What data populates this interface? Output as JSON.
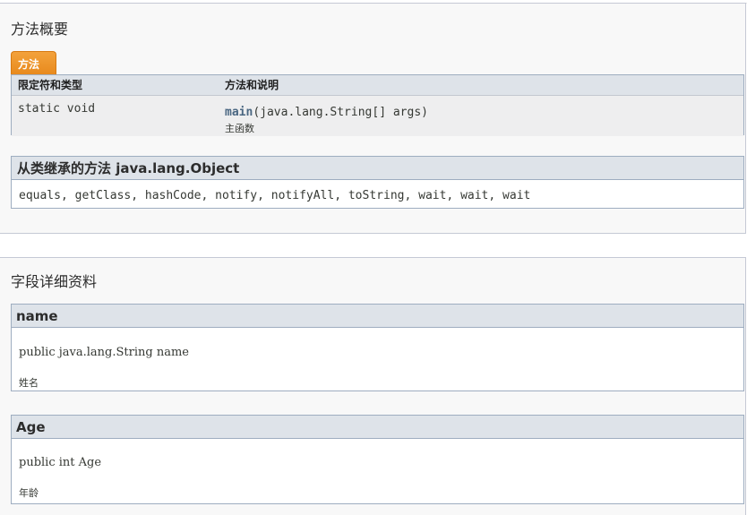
{
  "method_summary": {
    "title": "方法概要",
    "tab_label": "方法",
    "table": {
      "headers": [
        "限定符和类型",
        "方法和说明"
      ],
      "rows": [
        {
          "modifier": "static void",
          "method_name": "main",
          "method_params": "(java.lang.String[] args)",
          "description": "主函数"
        }
      ]
    },
    "inherited": {
      "title": "从类继承的方法 java.lang.Object",
      "methods": "equals, getClass, hashCode, notify, notifyAll, toString, wait, wait, wait"
    }
  },
  "field_details": {
    "title": "字段详细资料",
    "fields": [
      {
        "name": "name",
        "signature": "public java.lang.String name",
        "description": "姓名"
      },
      {
        "name": "Age",
        "signature": "public int Age",
        "description": "年龄"
      }
    ]
  },
  "colors": {
    "tab_orange": "#ee9a2c",
    "method_link": "#4a6782",
    "table_header_bg": "#dee3e9",
    "panel_bg": "#f8f8f8"
  }
}
